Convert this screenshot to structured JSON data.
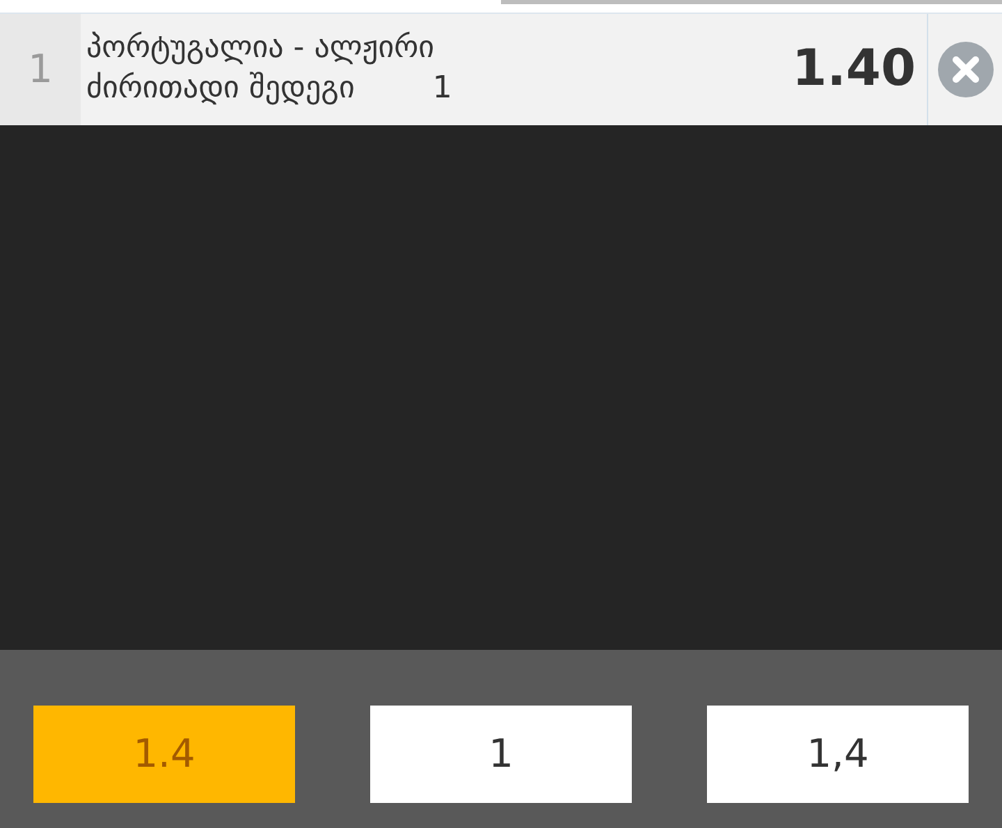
{
  "bet": {
    "index": "1",
    "match": "პორტუგალია - ალჟირი",
    "market": "ძირითადი შედეგი",
    "pick": "1",
    "odds": "1.40"
  },
  "options": [
    {
      "value": "1.4",
      "selected": true
    },
    {
      "value": "1",
      "selected": false
    },
    {
      "value": "1,4",
      "selected": false
    }
  ]
}
